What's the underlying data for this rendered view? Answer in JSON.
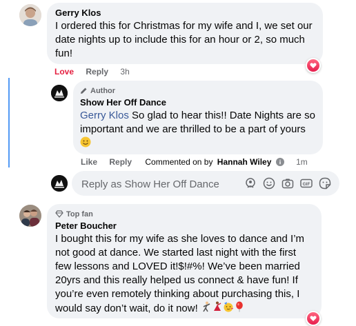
{
  "comment1": {
    "author": "Gerry Klos",
    "text": "I ordered this for Christmas for my wife and I, we set our date nights up to include this for an hour or 2, so much fun!",
    "actions": {
      "love": "Love",
      "reply": "Reply",
      "time": "3h"
    }
  },
  "reply1": {
    "badge": "Author",
    "author": "Show Her Off Dance",
    "mention": "Gerry Klos",
    "text": " So glad to hear this!! Date Nights are so important and we are thrilled to be a part of yours",
    "emoji_icon": "smile-emoji",
    "actions": {
      "like": "Like",
      "reply": "Reply",
      "commented_on_by": "Commented on by",
      "commenter": "Hannah Wiley",
      "time": "1m"
    }
  },
  "reply_box": {
    "placeholder": "Reply as Show Her Off Dance",
    "tools": [
      "avatar-sticker-icon",
      "emoji-icon",
      "camera-icon",
      "gif-icon",
      "sticker-icon"
    ]
  },
  "comment2": {
    "badge": "Top fan",
    "author": "Peter Boucher",
    "text": "I bought this for my wife as she loves to dance and I’m not good at dance. We started last night with the first few lessons and LOVED it!$!#%! We’ve been married 20yrs and this really helped us connect & have fun! If you’re even remotely thinking about purchasing this, I would say don’t wait, do it now!",
    "emojis": [
      "dancing-man-emoji",
      "dancing-woman-emoji",
      "party-face-emoji",
      "balloon-emoji"
    ]
  },
  "colors": {
    "bubble": "#f0f2f5",
    "link": "#385898",
    "love": "#e41e3f",
    "meta": "#65676b",
    "thread": "#1877f2"
  }
}
